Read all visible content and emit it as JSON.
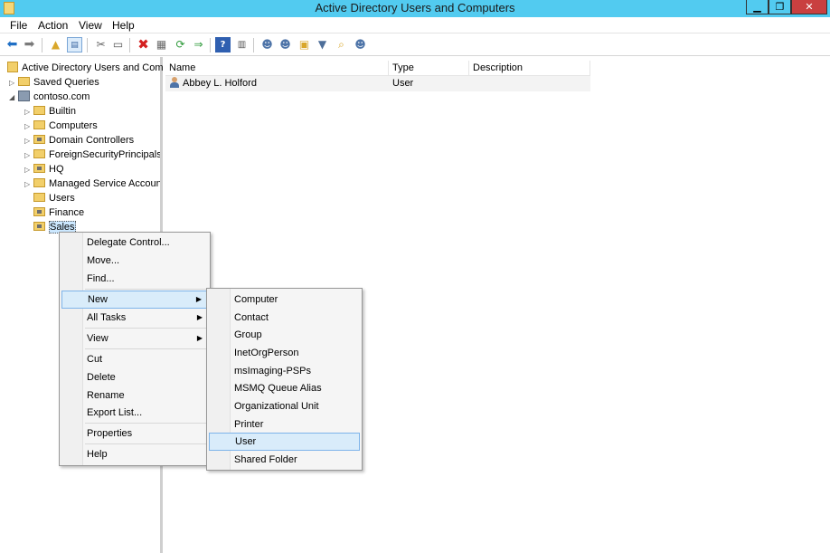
{
  "window": {
    "title": "Active Directory Users and Computers",
    "min_glyph": "▁",
    "max_glyph": "❐",
    "close_glyph": "✕"
  },
  "menubar": {
    "items": [
      "File",
      "Action",
      "View",
      "Help"
    ]
  },
  "toolbar": {
    "icons": [
      "back-arrow-icon",
      "forward-arrow-icon",
      "up-folder-icon",
      "show-hide-tree-icon",
      "cut-icon",
      "copy-icon",
      "delete-icon",
      "properties-icon",
      "refresh-icon",
      "export-list-icon",
      "help-icon",
      "action-pane-icon",
      "new-user-icon",
      "new-group-icon",
      "new-ou-icon",
      "filter-icon",
      "find-icon",
      "add-to-group-icon"
    ]
  },
  "tree": {
    "root": "Active Directory Users and Com",
    "saved_queries": "Saved Queries",
    "domain": "contoso.com",
    "children": [
      "Builtin",
      "Computers",
      "Domain Controllers",
      "ForeignSecurityPrincipals",
      "HQ",
      "Managed Service Accoun",
      "Users",
      "Finance",
      "Sales"
    ]
  },
  "list": {
    "columns": [
      "Name",
      "Type",
      "Description"
    ],
    "rows": [
      {
        "name": "Abbey L. Holford",
        "type": "User",
        "description": ""
      }
    ]
  },
  "context_menu": {
    "delegate": "Delegate Control...",
    "move": "Move...",
    "find": "Find...",
    "new": "New",
    "all_tasks": "All Tasks",
    "view": "View",
    "cut": "Cut",
    "delete": "Delete",
    "rename": "Rename",
    "export": "Export List...",
    "properties": "Properties",
    "help": "Help",
    "submenu_arrow": "▶"
  },
  "new_submenu": {
    "items": [
      "Computer",
      "Contact",
      "Group",
      "InetOrgPerson",
      "msImaging-PSPs",
      "MSMQ Queue Alias",
      "Organizational Unit",
      "Printer",
      "User",
      "Shared Folder"
    ],
    "highlighted": "User"
  }
}
